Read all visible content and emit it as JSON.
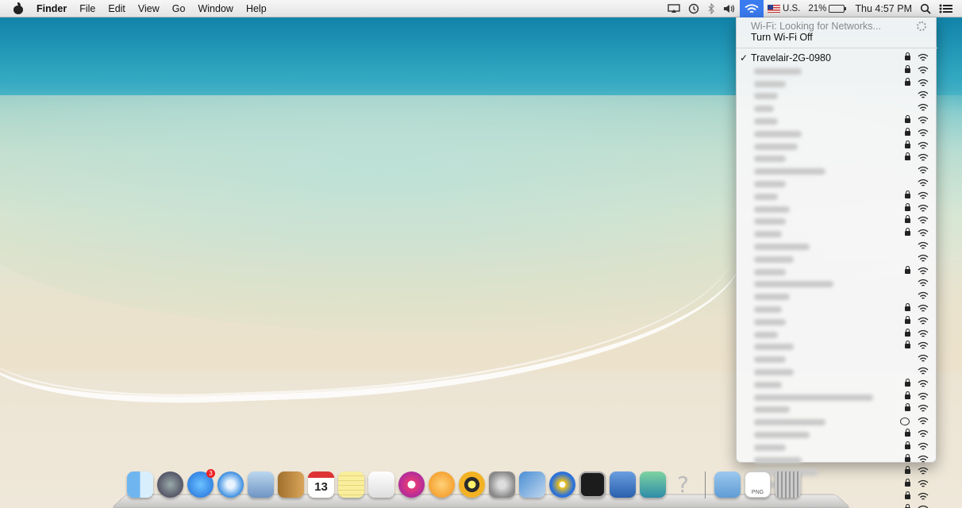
{
  "menubar": {
    "app_name": "Finder",
    "items": [
      "File",
      "Edit",
      "View",
      "Go",
      "Window",
      "Help"
    ],
    "status": {
      "input_source": "U.S.",
      "battery_percent": "21%",
      "clock": "Thu 4:57 PM"
    }
  },
  "wifi_menu": {
    "status_text": "Wi-Fi: Looking for Networks...",
    "toggle_label": "Turn Wi-Fi Off",
    "connected_network": "Travelair-2G-0980",
    "networks": [
      {
        "name": "Travelair-2G-0980",
        "checked": true,
        "secure": true,
        "blurred": false,
        "bw": 0
      },
      {
        "secure": true,
        "blurred": true,
        "bw": 60
      },
      {
        "secure": true,
        "blurred": true,
        "bw": 40
      },
      {
        "secure": false,
        "blurred": true,
        "bw": 30
      },
      {
        "secure": false,
        "blurred": true,
        "bw": 25
      },
      {
        "secure": true,
        "blurred": true,
        "bw": 30
      },
      {
        "secure": true,
        "blurred": true,
        "bw": 60
      },
      {
        "secure": true,
        "blurred": true,
        "bw": 55
      },
      {
        "secure": true,
        "blurred": true,
        "bw": 40
      },
      {
        "secure": false,
        "blurred": true,
        "bw": 90
      },
      {
        "secure": false,
        "blurred": true,
        "bw": 40
      },
      {
        "secure": true,
        "blurred": true,
        "bw": 30
      },
      {
        "secure": true,
        "blurred": true,
        "bw": 45
      },
      {
        "secure": true,
        "blurred": true,
        "bw": 40
      },
      {
        "secure": true,
        "blurred": true,
        "bw": 35
      },
      {
        "secure": false,
        "blurred": true,
        "bw": 70
      },
      {
        "secure": false,
        "blurred": true,
        "bw": 50
      },
      {
        "secure": true,
        "blurred": true,
        "bw": 40
      },
      {
        "secure": false,
        "blurred": true,
        "bw": 100
      },
      {
        "secure": false,
        "blurred": true,
        "bw": 45
      },
      {
        "secure": true,
        "blurred": true,
        "bw": 35
      },
      {
        "secure": true,
        "blurred": true,
        "bw": 40
      },
      {
        "secure": true,
        "blurred": true,
        "bw": 30
      },
      {
        "secure": true,
        "blurred": true,
        "bw": 50
      },
      {
        "secure": false,
        "blurred": true,
        "bw": 40
      },
      {
        "secure": false,
        "blurred": true,
        "bw": 50
      },
      {
        "secure": true,
        "blurred": true,
        "bw": 35
      },
      {
        "secure": true,
        "blurred": true,
        "bw": 150
      },
      {
        "secure": true,
        "blurred": true,
        "bw": 45
      },
      {
        "secure": false,
        "blurred": true,
        "bw": 90,
        "linked": true
      },
      {
        "secure": true,
        "blurred": true,
        "bw": 70
      },
      {
        "secure": true,
        "blurred": true,
        "bw": 40
      },
      {
        "secure": true,
        "blurred": true,
        "bw": 60
      },
      {
        "secure": true,
        "blurred": true,
        "bw": 80
      },
      {
        "secure": true,
        "blurred": true,
        "bw": 50
      },
      {
        "secure": true,
        "blurred": true,
        "bw": 40
      },
      {
        "secure": true,
        "blurred": true,
        "bw": 110
      }
    ]
  },
  "dock": {
    "calendar_date": "13",
    "app_store_badge": "3",
    "apps": [
      "finder-icon",
      "launchpad-icon",
      "app-store-icon",
      "safari-icon",
      "mail-icon",
      "contacts-icon",
      "calendar-icon",
      "notes-icon",
      "reminders-icon",
      "itunes-icon",
      "ibooks-icon",
      "burn-icon",
      "system-preferences-icon",
      "xcode-icon",
      "wunderlist-icon",
      "terminal-icon",
      "automator-icon",
      "preview-icon",
      "help-icon"
    ],
    "right_items": [
      "downloads-folder-icon",
      "png-document-icon",
      "trash-icon"
    ],
    "png_label": "PNG"
  },
  "colors": {
    "accent": "#3b7bf0",
    "menubar": "#ececec"
  }
}
